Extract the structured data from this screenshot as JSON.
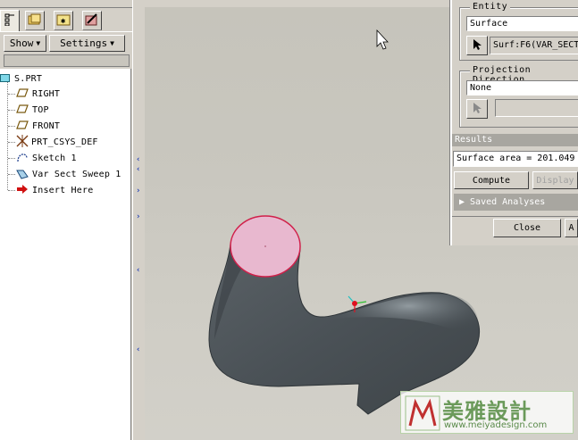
{
  "navigator": {
    "show_label": "Show",
    "settings_label": "Settings",
    "tree": [
      {
        "label": "S.PRT",
        "icon": "part-icon"
      },
      {
        "label": "RIGHT",
        "icon": "datum-plane-icon"
      },
      {
        "label": "TOP",
        "icon": "datum-plane-icon"
      },
      {
        "label": "FRONT",
        "icon": "datum-plane-icon"
      },
      {
        "label": "PRT_CSYS_DEF",
        "icon": "coordinate-system-icon"
      },
      {
        "label": "Sketch 1",
        "icon": "sketch-icon"
      },
      {
        "label": "Var Sect Sweep 1",
        "icon": "sweep-icon"
      },
      {
        "label": "Insert Here",
        "icon": "insert-arrow-icon"
      }
    ]
  },
  "dialog": {
    "entity_title": "Entity",
    "entity_type": "Surface",
    "entity_ref": "Surf:F6(VAR_SECT",
    "projection_title": "Projection Direction",
    "projection_value": "None",
    "results_title": "Results",
    "result_value": "Surface area = 201.049",
    "compute_label": "Compute",
    "display_label": "Display",
    "saved_analyses_label": "Saved Analyses",
    "close_label": "Close",
    "apply_label": "A"
  },
  "watermark": {
    "title": "美雅設計",
    "url": "www.meiyadesign.com"
  },
  "colors": {
    "dialog_bg": "#d4d0c8",
    "viewport_bg": "#c9c7bf",
    "model_body": "#4c5358",
    "selected_surface": "#e8b8cf",
    "selection_edge": "#d0204a",
    "watermark_green": "#6b9a5a"
  }
}
